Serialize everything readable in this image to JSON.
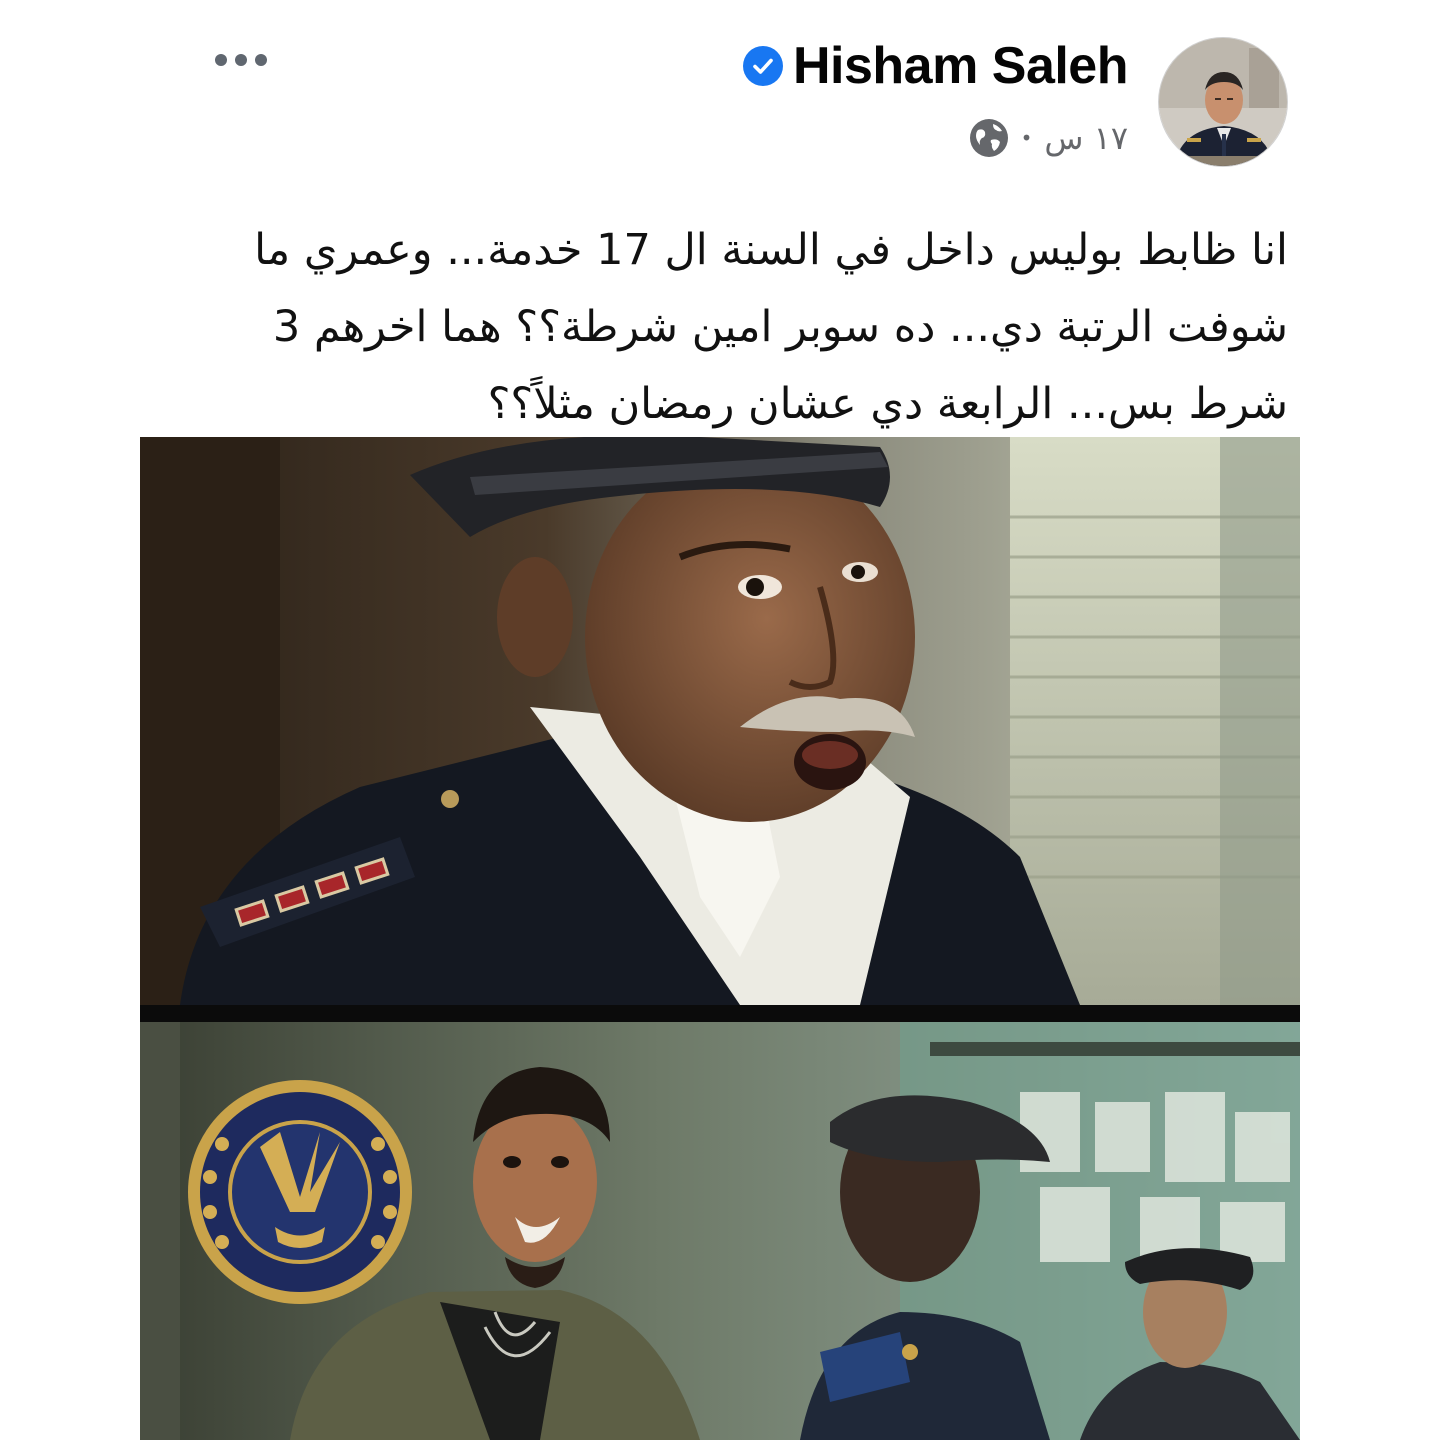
{
  "post": {
    "author": {
      "name": "Hisham Saleh",
      "verified": true,
      "avatar_icon": "officer-avatar"
    },
    "meta": {
      "time": "١٧ س",
      "separator": "•",
      "audience_icon": "globe-icon"
    },
    "more_icon": "more-options-icon",
    "text_lines": [
      "انا ظابط بوليس داخل في السنة ال 17 خدمة... وعمري ما",
      "شوفت الرتبة دي... ده سوبر امين شرطة؟؟ هما اخرهم 3",
      "شرط بس... الرابعة دي عشان رمضان مثلاً؟؟"
    ],
    "photos": [
      {
        "subject": "police-officer-with-four-stripes"
      },
      {
        "subject": "police-station-scene-with-emblem"
      }
    ]
  },
  "colors": {
    "verified_badge": "#1877f2",
    "meta_text": "#65676b",
    "text": "#050505"
  }
}
